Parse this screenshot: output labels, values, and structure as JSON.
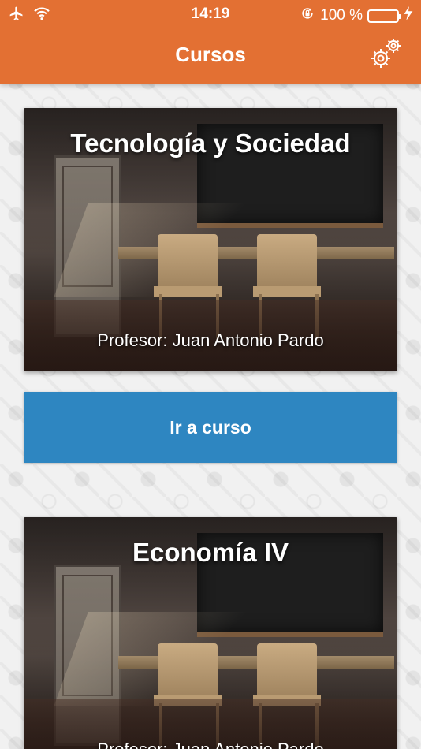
{
  "status_bar": {
    "time": "14:19",
    "battery_percent": "100 %",
    "icons": [
      "airplane-icon",
      "wifi-icon",
      "orientation-lock-icon",
      "battery-icon",
      "charging-icon"
    ]
  },
  "nav": {
    "title": "Cursos",
    "settings_icon": "gear-icon"
  },
  "colors": {
    "header": "#e37033",
    "button": "#2e86c1",
    "battery": "#4cd964"
  },
  "courses": [
    {
      "title": "Tecnología y Sociedad",
      "professor": "Profesor: Juan Antonio Pardo",
      "button_label": "Ir a curso"
    },
    {
      "title": "Economía IV",
      "professor": "Profesor: Juan Antonio Pardo"
    }
  ]
}
